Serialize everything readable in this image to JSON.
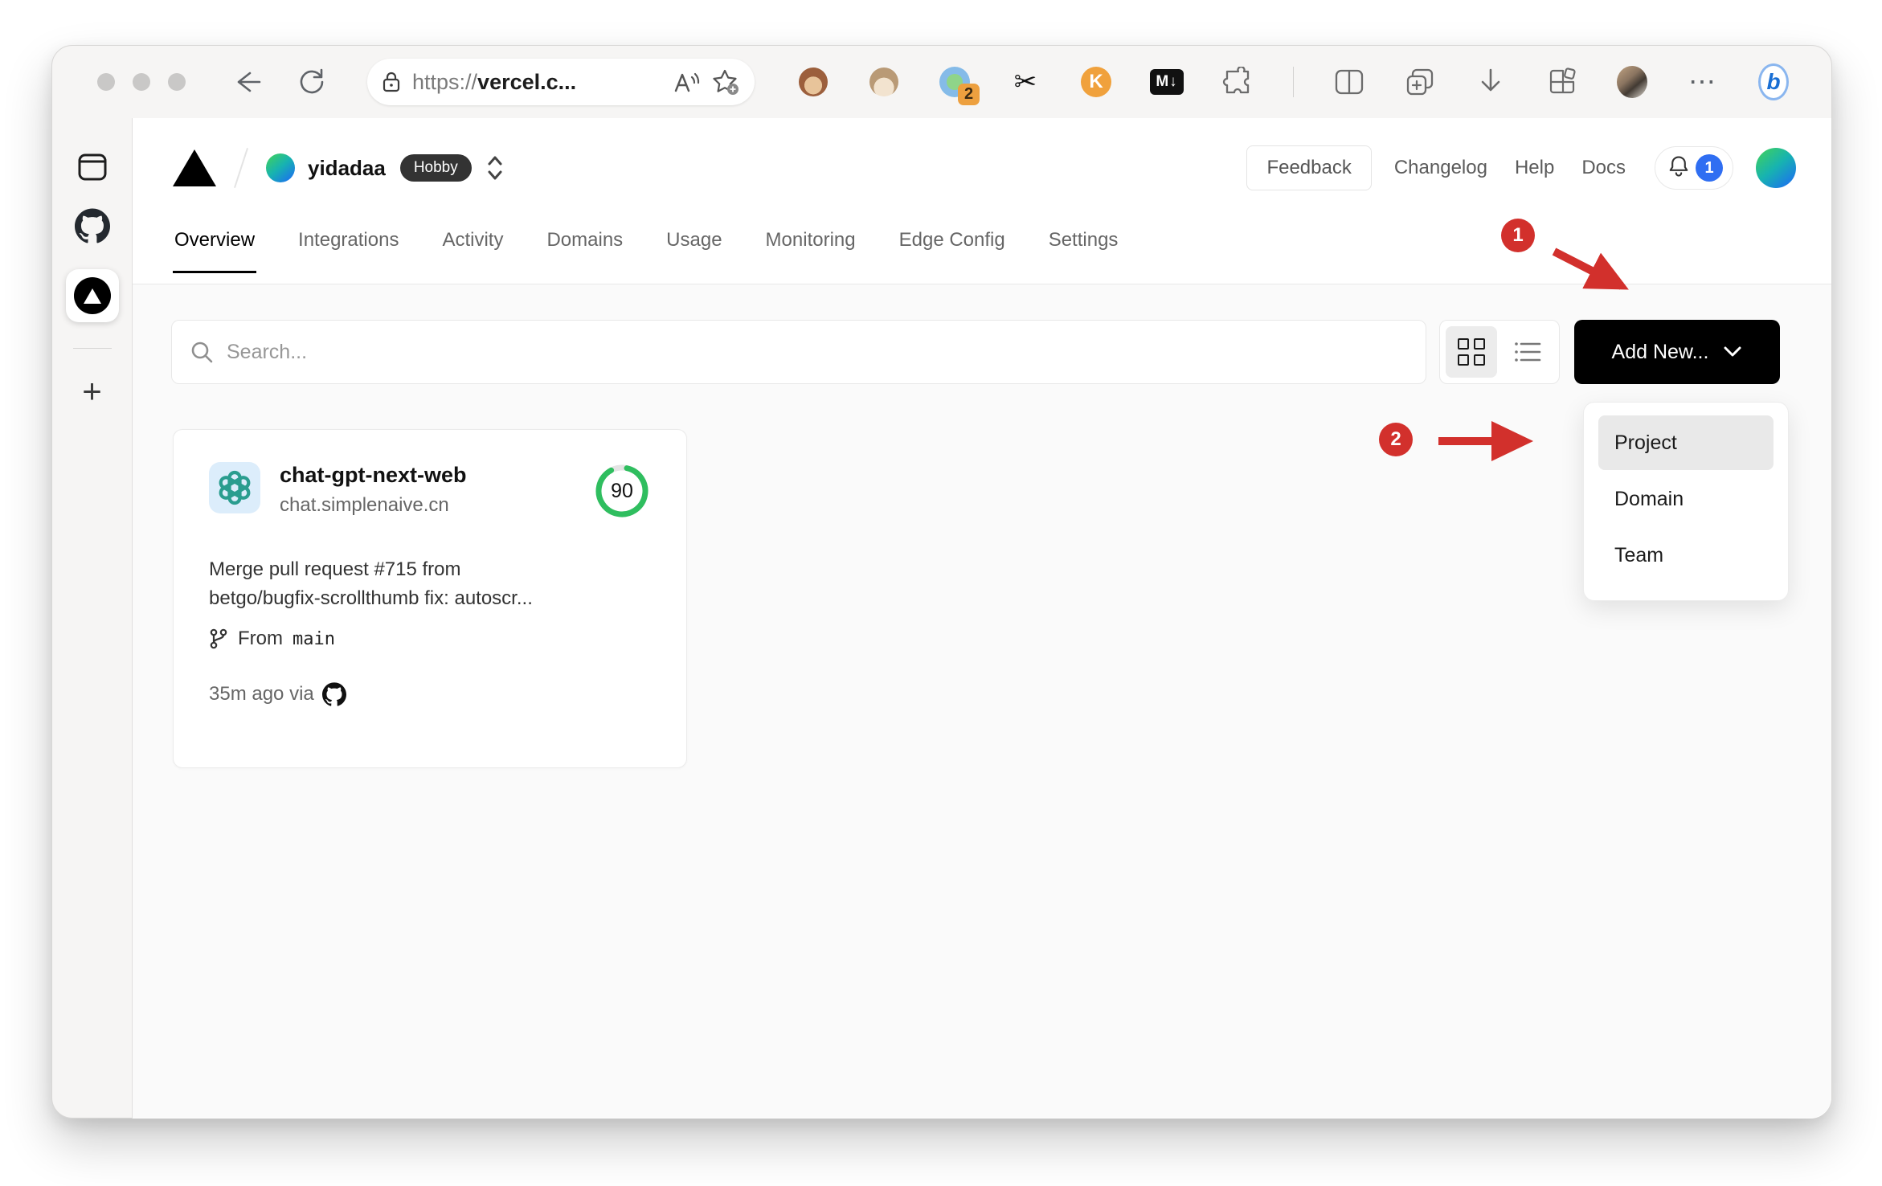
{
  "colors": {
    "annotation_red": "#d2302c",
    "score_green": "#2fbe5f",
    "notification_blue": "#2f6ef2",
    "extension_badge_orange": "#eda03f",
    "add_new_black": "#000000",
    "plan_badge_dark": "#333333"
  },
  "browser": {
    "url_prefix": "https://",
    "url_host": "vercel.c...",
    "extension_badge_count": "2",
    "scissors_glyph": "✂",
    "k_extension_label": "K",
    "markdown_extension_label": "M↓",
    "more_label": "⋯",
    "bing_label": "b",
    "sidebar_new_tab": "+"
  },
  "header": {
    "team_name": "yidadaa",
    "plan_badge": "Hobby",
    "feedback": "Feedback",
    "changelog": "Changelog",
    "help": "Help",
    "docs": "Docs",
    "notification_count": "1"
  },
  "tabs": [
    "Overview",
    "Integrations",
    "Activity",
    "Domains",
    "Usage",
    "Monitoring",
    "Edge Config",
    "Settings"
  ],
  "controls": {
    "search_placeholder": "Search...",
    "add_new": "Add New..."
  },
  "project": {
    "name": "chat-gpt-next-web",
    "domain": "chat.simplenaive.cn",
    "score": "90",
    "commit_line1": "Merge pull request #715 from",
    "commit_line2": "betgo/bugfix-scrollthumb fix: autoscr...",
    "branch_prefix": "From",
    "branch_name": "main",
    "deployed": "35m ago via"
  },
  "dropdown": {
    "items": [
      "Project",
      "Domain",
      "Team"
    ],
    "highlighted": "Project"
  },
  "annotations": {
    "step1": "1",
    "step2": "2"
  }
}
